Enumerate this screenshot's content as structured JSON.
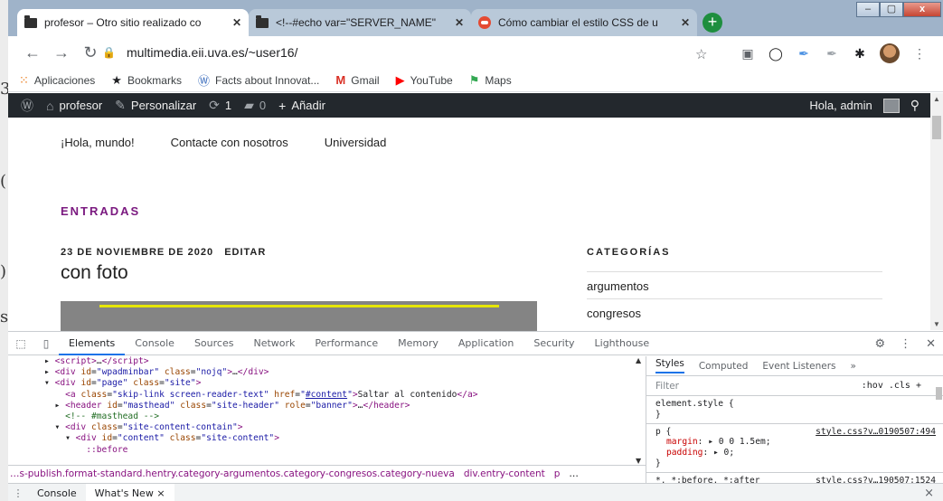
{
  "browser": {
    "tabs": [
      {
        "title": "profesor – Otro sitio realizado co",
        "icon": "folder-icon",
        "active": true
      },
      {
        "title": "<!--#echo var=\"SERVER_NAME\"",
        "icon": "folder-icon",
        "active": false
      },
      {
        "title": "Cómo cambiar el estilo CSS de u",
        "icon": "red-icon",
        "active": false
      }
    ],
    "new_tab": "+",
    "window_controls": {
      "minimize": "–",
      "maximize": "▢",
      "close": "x"
    },
    "url": "multimedia.eii.uva.es/~user16/",
    "bookmarks": [
      {
        "label": "Aplicaciones",
        "icon": "apps-icon",
        "color": "#e8710a"
      },
      {
        "label": "Bookmarks",
        "icon": "star-icon",
        "color": "#202124"
      },
      {
        "label": "Facts about Innovat...",
        "icon": "wp-icon",
        "color": "#3b6dbd"
      },
      {
        "label": "Gmail",
        "icon": "gmail-icon",
        "color": "#d93025"
      },
      {
        "label": "YouTube",
        "icon": "youtube-icon",
        "color": "#ff0000"
      },
      {
        "label": "Maps",
        "icon": "maps-icon",
        "color": "#34a853"
      }
    ]
  },
  "wp_admin_bar": {
    "items": [
      {
        "label": "profesor",
        "icon": "home-icon"
      },
      {
        "label": "Personalizar",
        "icon": "brush-icon"
      },
      {
        "label": "1",
        "icon": "refresh-icon"
      },
      {
        "label": "0",
        "icon": "comment-icon"
      },
      {
        "label": "Añadir",
        "icon": "plus-icon"
      }
    ],
    "greeting": "Hola, admin"
  },
  "site": {
    "nav": [
      "¡Hola, mundo!",
      "Contacte con nosotros",
      "Universidad"
    ],
    "section_heading": "ENTRADAS",
    "post": {
      "date": "23 DE NOVIEMBRE DE 2020",
      "edit": "EDITAR",
      "title": "con foto"
    },
    "sidebar": {
      "heading": "CATEGORÍAS",
      "categories": [
        "argumentos",
        "congresos"
      ]
    },
    "accent": "#7b1a80"
  },
  "devtools": {
    "tabs": [
      "Elements",
      "Console",
      "Sources",
      "Network",
      "Performance",
      "Memory",
      "Application",
      "Security",
      "Lighthouse"
    ],
    "active_tab": "Elements",
    "styles_tabs": [
      "Styles",
      "Computed",
      "Event Listeners",
      "»"
    ],
    "filter_placeholder": "Filter",
    "filter_tools": ":hov  .cls  +",
    "rules": [
      {
        "selector": "element.style {",
        "lines": [],
        "close": "}",
        "source": ""
      },
      {
        "selector": "p {",
        "lines": [
          {
            "prop": "margin",
            "val": "▸ 0 0 1.5em;"
          },
          {
            "prop": "padding",
            "val": "▸ 0;"
          }
        ],
        "close": "}",
        "source": "style.css?v…0190507:494"
      },
      {
        "selector": "*, *:before, *:after",
        "lines": [],
        "close": "",
        "source": "style.css?v…190507:1524"
      }
    ],
    "breadcrumb": [
      "…s-publish.format-standard.hentry.category-argumentos.category-congresos.category-nueva",
      "div.entry-content",
      "p",
      "…"
    ],
    "drawer": {
      "tabs": [
        "Console",
        "What's New ×"
      ],
      "close": "×"
    }
  }
}
